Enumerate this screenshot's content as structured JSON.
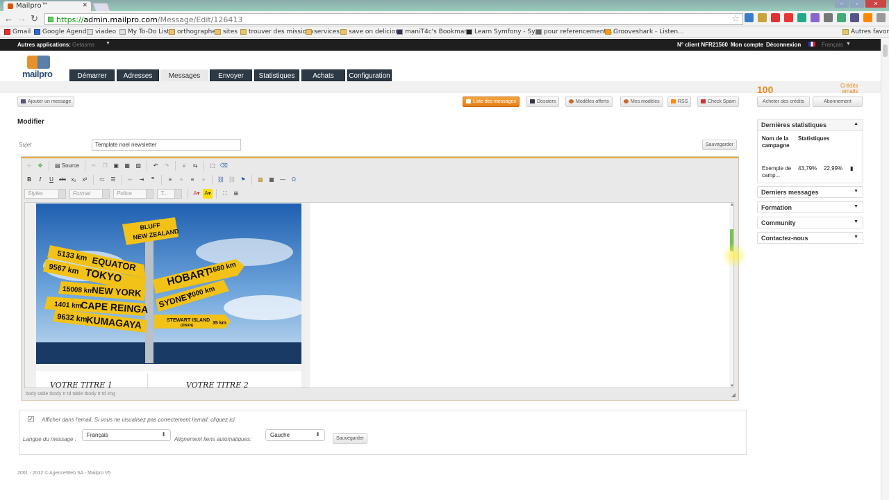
{
  "browser": {
    "tab_title": "Mailpro™",
    "url_scheme": "https://",
    "url_host": "admin.mailpro.com",
    "url_path": "/Message/Edit/126413",
    "bookmarks": [
      "Gmail",
      "Google Agenda",
      "viadeo",
      "My To-Do List",
      "orthographe",
      "sites",
      "trouver des missions",
      "services",
      "save on delicious",
      "maniT4c's Bookmar...",
      "Learn Symfony - Sy...",
      "pour referencement ...",
      "Grooveshark - Listen..."
    ],
    "other_bookmarks": "Autres favoris"
  },
  "topbar": {
    "apps_label": "Autres applications:",
    "apps_value": "Getasms",
    "client": "N° client NFR21560",
    "account": "Mon compte",
    "logout": "Déconnexion",
    "language": "Français"
  },
  "logo": {
    "text": "mailpro"
  },
  "nav": {
    "tabs": [
      "Démarrer",
      "Adresses",
      "Messages",
      "Envoyer",
      "Statistiques",
      "Achats",
      "Configuration"
    ]
  },
  "credits": {
    "count": "100",
    "label_line1": "Crédits",
    "label_line2": "emails"
  },
  "actions": {
    "add_message": "Ajouter un message",
    "list_messages": "Liste des messages",
    "folders": "Dossiers",
    "templates_offered": "Modèles offerts",
    "my_templates": "Mes modèles",
    "rss": "RSS",
    "check_spam": "Check Spam",
    "buy_credits": "Acheter des crédits",
    "subscription": "Abonnement"
  },
  "form": {
    "title": "Modifier",
    "subject_label": "Sujet",
    "subject_value": "Template noel newsletter",
    "save": "Sauvegarder"
  },
  "editor": {
    "source_label": "Source",
    "styles": "Styles",
    "format": "Format",
    "font": "Police",
    "size": "T...",
    "titles": [
      "VOTRE TITRE 1",
      "VOTRE TITRE 2"
    ],
    "path": "body  table  tbody  tr  td  table  tbody  tr  td  img"
  },
  "signpost": {
    "signs": [
      "BLUFF",
      "NEW ZEALAND",
      "5133 km",
      "EQUATOR",
      "9567 km",
      "TOKYO",
      "HOBART",
      "1680 km",
      "15008 km",
      "NEW YORK",
      "SYDNEY",
      "2000 km",
      "1401 km",
      "CAPE REINGA",
      "9632 km",
      "KUMAGAYA",
      "STEWART ISLAND",
      "(OBAN)",
      "35 km"
    ]
  },
  "options": {
    "show_in_email": "Afficher dans l'email: Si vous ne visualisez pas correctement l'email, cliquez ici",
    "language_label": "Langue du message :",
    "language_value": "Français",
    "alignment_label": "Alignement liens automatiques:",
    "alignment_value": "Gauche",
    "save": "Sauvegarder"
  },
  "sidebar": {
    "stats_title": "Dernières statistiques",
    "col_name": "Nom de la campagne",
    "col_stats": "Statistiques",
    "row_name": "Exemple de camp...",
    "row_open": "43,79%",
    "row_click": "22,99%",
    "sections": [
      "Derniers messages",
      "Formation",
      "Community",
      "Contactez-nous"
    ]
  },
  "footer": "2001 - 2012 © AgenceWeb SA - Mailpro V5",
  "colors": {
    "accent": "#e47d18",
    "nav": "#2d3a46",
    "thumb": "#7cc24f"
  }
}
